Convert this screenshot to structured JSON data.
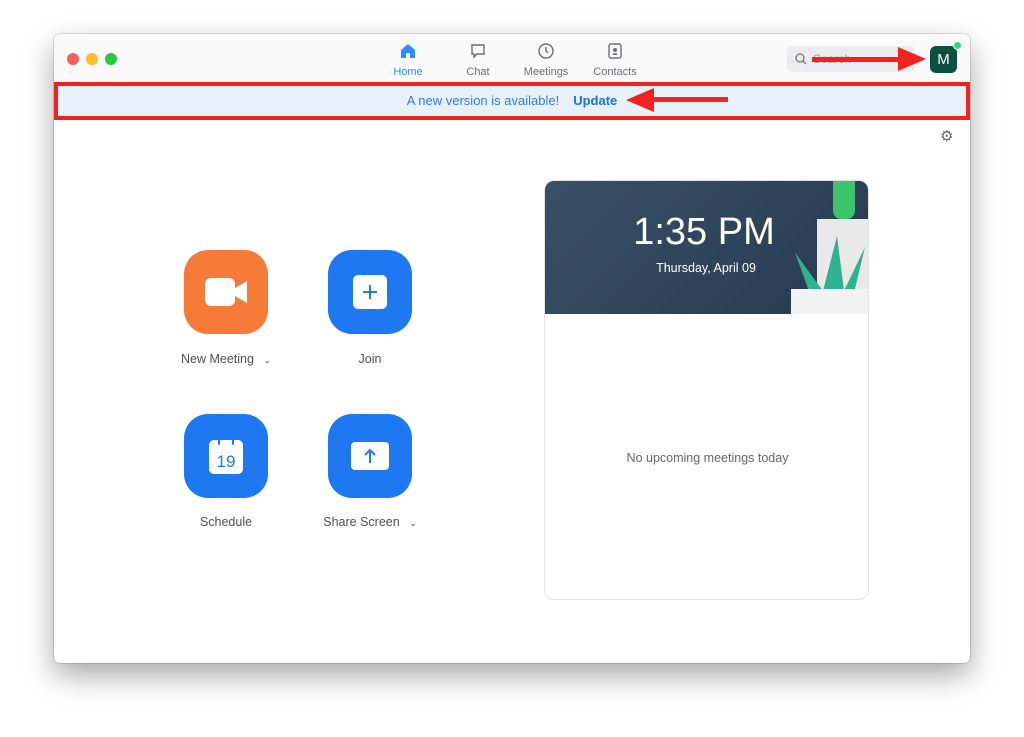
{
  "nav": {
    "tabs": [
      {
        "label": "Home",
        "icon": "home-icon",
        "active": true
      },
      {
        "label": "Chat",
        "icon": "chat-icon"
      },
      {
        "label": "Meetings",
        "icon": "clock-icon"
      },
      {
        "label": "Contacts",
        "icon": "contacts-icon"
      }
    ]
  },
  "search": {
    "placeholder": "Search"
  },
  "avatar": {
    "initial": "M",
    "status_color": "#3fd07a"
  },
  "banner": {
    "message": "A new version is available!",
    "action": "Update"
  },
  "actions": [
    {
      "label": "New Meeting",
      "has_dropdown": true,
      "color": "#f77b38"
    },
    {
      "label": "Join",
      "color": "#1d78f2"
    },
    {
      "label": "Schedule",
      "calendar_day": "19",
      "color": "#1d78f2"
    },
    {
      "label": "Share Screen",
      "has_dropdown": true,
      "color": "#1d78f2"
    }
  ],
  "clock": {
    "time": "1:35 PM",
    "date": "Thursday, April 09"
  },
  "meetings": {
    "empty_text": "No upcoming meetings today"
  },
  "annotation_color": "#f0231f"
}
